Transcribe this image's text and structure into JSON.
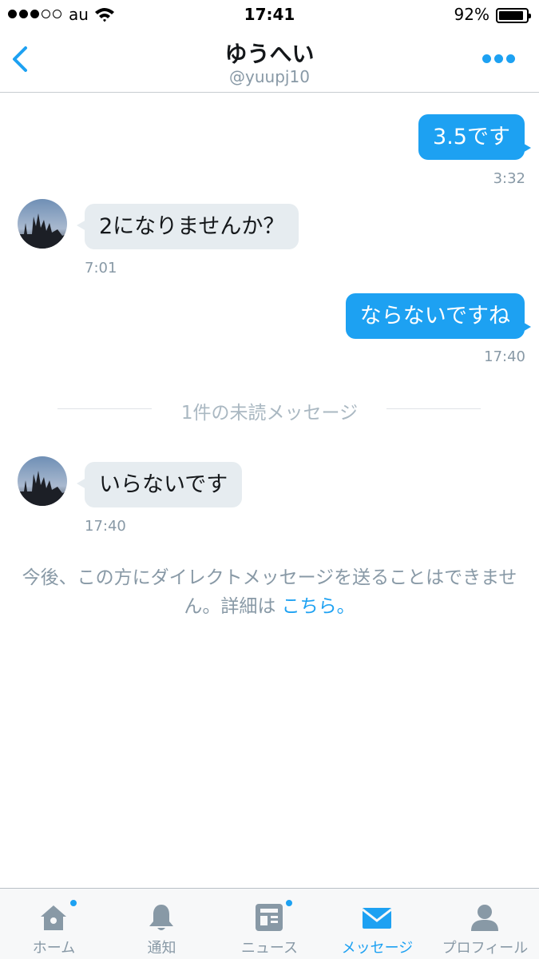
{
  "status_bar": {
    "carrier": "au",
    "time": "17:41",
    "battery_percent": "92%",
    "battery_level": 0.92,
    "signal_bars_filled": 3,
    "signal_bars_total": 5
  },
  "header": {
    "title": "ゆうへい",
    "handle": "@yuupj10",
    "back_icon": "chevron-left-icon",
    "more_icon": "more-dots-icon"
  },
  "messages": [
    {
      "direction": "sent",
      "text": "3.5です",
      "time": "3:32"
    },
    {
      "direction": "received",
      "text": "2になりませんか？",
      "time": "7:01"
    },
    {
      "direction": "sent",
      "text": "ならないですね",
      "time": "17:40"
    },
    {
      "direction": "received",
      "text": "いらないです",
      "time": "17:40"
    }
  ],
  "unread_separator": "1件の未読メッセージ",
  "notice": {
    "text": "今後、この方にダイレクトメッセージを送ることはできません。詳細は ",
    "link": "こちら。"
  },
  "tabs": [
    {
      "label": "ホーム",
      "icon": "home-icon",
      "badge": true,
      "active": false
    },
    {
      "label": "通知",
      "icon": "bell-icon",
      "badge": false,
      "active": false
    },
    {
      "label": "ニュース",
      "icon": "news-icon",
      "badge": true,
      "active": false
    },
    {
      "label": "メッセージ",
      "icon": "envelope-icon",
      "badge": false,
      "active": true
    },
    {
      "label": "プロフィール",
      "icon": "profile-icon",
      "badge": false,
      "active": false
    }
  ],
  "colors": {
    "accent": "#1da1f2",
    "bubble_received": "#e6ecf0",
    "muted_text": "#8899a6"
  }
}
